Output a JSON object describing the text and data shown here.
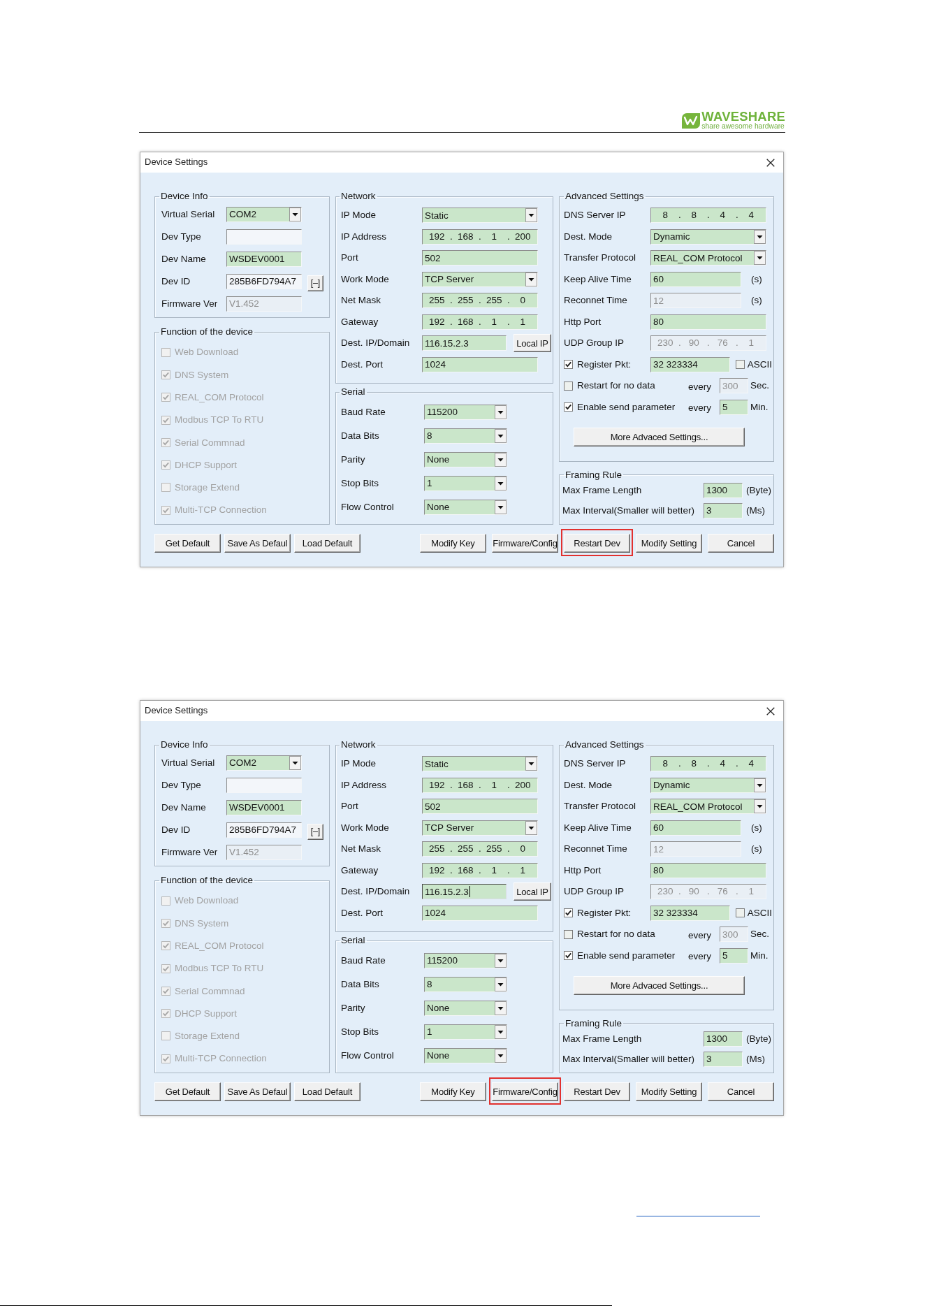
{
  "header": {
    "logo_name": "WAVESHARE",
    "tagline": "share awesome hardware"
  },
  "dialogs": [
    {
      "title": "Device Settings",
      "columns": [
        [
          {
            "title": "Device Info",
            "rows": [
              {
                "kind": "field",
                "label": "Virtual Serial",
                "field": {
                  "kind": "combo",
                  "value": "COM2",
                  "readonly": false,
                  "disabled": false,
                  "focused": false
                }
              },
              {
                "kind": "field",
                "label": "Dev Type",
                "field": {
                  "kind": "text",
                  "readonly": true,
                  "disabled": false,
                  "focused": false
                }
              },
              {
                "kind": "field",
                "label": "Dev Name",
                "field": {
                  "kind": "text",
                  "value": "WSDEV0001",
                  "readonly": false,
                  "disabled": false,
                  "focused": false
                }
              },
              {
                "kind": "field",
                "label": "Dev ID",
                "field": {
                  "kind": "text",
                  "value": "285B6FD794A7",
                  "readonly": true,
                  "disabled": false,
                  "focused": false
                },
                "button": "[–]"
              },
              {
                "kind": "field",
                "label": "Firmware Ver",
                "field": {
                  "kind": "text",
                  "value": "V1.452",
                  "readonly": false,
                  "disabled": true,
                  "focused": false
                }
              }
            ]
          },
          {
            "title": "Function of the device",
            "rows": [
              {
                "kind": "check",
                "label": "Web Download",
                "checked": false,
                "disabled": true
              },
              {
                "kind": "check",
                "label": "DNS System",
                "checked": true,
                "disabled": true
              },
              {
                "kind": "check",
                "label": "REAL_COM Protocol",
                "checked": true,
                "disabled": true
              },
              {
                "kind": "check",
                "label": "Modbus TCP To RTU",
                "checked": true,
                "disabled": true
              },
              {
                "kind": "check",
                "label": "Serial Commnad",
                "checked": true,
                "disabled": true
              },
              {
                "kind": "check",
                "label": "DHCP Support",
                "checked": true,
                "disabled": true
              },
              {
                "kind": "check",
                "label": "Storage Extend",
                "checked": false,
                "disabled": true
              },
              {
                "kind": "check",
                "label": "Multi-TCP Connection",
                "checked": true,
                "disabled": true
              }
            ]
          }
        ],
        [
          {
            "title": "Network",
            "rows": [
              {
                "kind": "field",
                "label": "IP Mode",
                "field": {
                  "kind": "combo",
                  "value": "Static",
                  "readonly": false,
                  "disabled": false,
                  "focused": false
                }
              },
              {
                "kind": "field",
                "label": "IP Address",
                "field": {
                  "kind": "ip",
                  "value": "192 . 168 . 1 . 200",
                  "readonly": false,
                  "disabled": false,
                  "focused": false
                }
              },
              {
                "kind": "field",
                "label": "Port",
                "field": {
                  "kind": "text",
                  "value": "502",
                  "readonly": false,
                  "disabled": false,
                  "focused": false
                }
              },
              {
                "kind": "field",
                "label": "Work Mode",
                "field": {
                  "kind": "combo",
                  "value": "TCP Server",
                  "readonly": false,
                  "disabled": false,
                  "focused": false
                }
              },
              {
                "kind": "field",
                "label": "Net Mask",
                "field": {
                  "kind": "ip",
                  "value": "255 . 255 . 255 . 0",
                  "readonly": false,
                  "disabled": false,
                  "focused": false
                }
              },
              {
                "kind": "field",
                "label": "Gateway",
                "field": {
                  "kind": "ip",
                  "value": "192 . 168 . 1 . 1",
                  "readonly": false,
                  "disabled": false,
                  "focused": false
                }
              },
              {
                "kind": "field",
                "label": "Dest. IP/Domain",
                "field": {
                  "kind": "text",
                  "value": "116.15.2.3",
                  "readonly": false,
                  "disabled": false,
                  "focused": false
                },
                "button": "Local IP"
              },
              {
                "kind": "field",
                "label": "Dest. Port",
                "field": {
                  "kind": "text",
                  "value": "1024",
                  "readonly": false,
                  "disabled": false,
                  "focused": false
                }
              }
            ]
          },
          {
            "title": "Serial",
            "rows": [
              {
                "kind": "field",
                "label": "Baud Rate",
                "field": {
                  "kind": "combo",
                  "value": "115200",
                  "readonly": false,
                  "disabled": false,
                  "focused": false
                }
              },
              {
                "kind": "field",
                "label": "Data Bits",
                "field": {
                  "kind": "combo",
                  "value": "8",
                  "readonly": false,
                  "disabled": false,
                  "focused": false
                }
              },
              {
                "kind": "field",
                "label": "Parity",
                "field": {
                  "kind": "combo",
                  "value": "None",
                  "readonly": false,
                  "disabled": false,
                  "focused": false
                }
              },
              {
                "kind": "field",
                "label": "Stop Bits",
                "field": {
                  "kind": "combo",
                  "value": "1",
                  "readonly": false,
                  "disabled": false,
                  "focused": false
                }
              },
              {
                "kind": "field",
                "label": "Flow Control",
                "field": {
                  "kind": "combo",
                  "value": "None",
                  "readonly": false,
                  "disabled": false,
                  "focused": false
                }
              }
            ]
          }
        ],
        [
          {
            "title": "Advanced Settings",
            "rows": [
              {
                "kind": "field",
                "label": "DNS Server IP",
                "field": {
                  "kind": "ip",
                  "value": "8 . 8 . 4 . 4",
                  "readonly": false,
                  "disabled": false,
                  "focused": false
                }
              },
              {
                "kind": "field",
                "label": "Dest. Mode",
                "field": {
                  "kind": "combo",
                  "value": "Dynamic",
                  "readonly": false,
                  "disabled": false,
                  "focused": false
                }
              },
              {
                "kind": "field",
                "label": "Transfer Protocol",
                "field": {
                  "kind": "combo",
                  "value": "REAL_COM Protocol",
                  "readonly": false,
                  "disabled": false,
                  "focused": false
                }
              },
              {
                "kind": "field",
                "label": "Keep Alive Time",
                "field": {
                  "kind": "text",
                  "value": "60",
                  "readonly": false,
                  "disabled": false,
                  "focused": false
                },
                "unit": "(s)"
              },
              {
                "kind": "field",
                "label": "Reconnet Time",
                "field": {
                  "kind": "text",
                  "value": "12",
                  "readonly": false,
                  "disabled": true,
                  "focused": false
                },
                "unit": "(s)"
              },
              {
                "kind": "field",
                "label": "Http Port",
                "field": {
                  "kind": "text",
                  "value": "80",
                  "readonly": false,
                  "disabled": false,
                  "focused": false
                }
              },
              {
                "kind": "field",
                "label": "UDP Group IP",
                "field": {
                  "kind": "ip",
                  "value": "230 . 90 . 76 . 1",
                  "readonly": false,
                  "disabled": true,
                  "focused": false
                }
              },
              {
                "kind": "check_field",
                "label": "Register Pkt:",
                "checked": true,
                "disabled": false,
                "field": {
                  "kind": "text",
                  "value": "32 323334",
                  "readonly": false,
                  "disabled": false,
                  "focused": false
                },
                "option": {
                  "label": "ASCII",
                  "checked": false,
                  "disabled": false
                }
              },
              {
                "kind": "check_every",
                "label": "Restart for no data",
                "checked": false,
                "disabled": false,
                "every": "every",
                "field": {
                  "kind": "text",
                  "value": "300",
                  "readonly": false,
                  "disabled": true,
                  "focused": false
                },
                "unit": "Sec."
              },
              {
                "kind": "check_every",
                "label": "Enable send parameter",
                "checked": true,
                "disabled": false,
                "every": "every",
                "field": {
                  "kind": "text",
                  "value": "5",
                  "readonly": false,
                  "disabled": false,
                  "focused": false
                },
                "unit": "Min."
              },
              {
                "kind": "button",
                "label": "More Advaced Settings..."
              }
            ]
          },
          {
            "title": "Framing Rule",
            "rows": [
              {
                "kind": "field",
                "label": "Max Frame Length",
                "field": {
                  "kind": "text",
                  "value": "1300",
                  "readonly": false,
                  "disabled": false,
                  "focused": false
                },
                "unit": "(Byte)"
              },
              {
                "kind": "field",
                "label": "Max Interval(Smaller will better)",
                "field": {
                  "kind": "text",
                  "value": "3",
                  "readonly": false,
                  "disabled": false,
                  "focused": false
                },
                "unit": "(Ms)"
              }
            ]
          }
        ]
      ],
      "buttons_left": [
        {
          "label": "Get Default",
          "highlighted": false
        },
        {
          "label": "Save As Defaul",
          "highlighted": false
        },
        {
          "label": "Load Default",
          "highlighted": false
        }
      ],
      "buttons_right": [
        {
          "label": "Modify Key",
          "highlighted": false
        },
        {
          "label": "Firmware/Config",
          "highlighted": false
        },
        {
          "label": "Restart Dev",
          "highlighted": true
        },
        {
          "label": "Modify Setting",
          "highlighted": false
        },
        {
          "label": "Cancel",
          "highlighted": false
        }
      ]
    },
    {
      "title": "Device Settings",
      "columns": [
        [
          {
            "title": "Device Info",
            "rows": [
              {
                "kind": "field",
                "label": "Virtual Serial",
                "field": {
                  "kind": "combo",
                  "value": "COM2",
                  "readonly": false,
                  "disabled": false,
                  "focused": false
                }
              },
              {
                "kind": "field",
                "label": "Dev Type",
                "field": {
                  "kind": "text",
                  "readonly": true,
                  "disabled": false,
                  "focused": false
                }
              },
              {
                "kind": "field",
                "label": "Dev Name",
                "field": {
                  "kind": "text",
                  "value": "WSDEV0001",
                  "readonly": false,
                  "disabled": false,
                  "focused": false
                }
              },
              {
                "kind": "field",
                "label": "Dev ID",
                "field": {
                  "kind": "text",
                  "value": "285B6FD794A7",
                  "readonly": true,
                  "disabled": false,
                  "focused": false
                },
                "button": "[–]"
              },
              {
                "kind": "field",
                "label": "Firmware Ver",
                "field": {
                  "kind": "text",
                  "value": "V1.452",
                  "readonly": false,
                  "disabled": true,
                  "focused": false
                }
              }
            ]
          },
          {
            "title": "Function of the device",
            "rows": [
              {
                "kind": "check",
                "label": "Web Download",
                "checked": false,
                "disabled": true
              },
              {
                "kind": "check",
                "label": "DNS System",
                "checked": true,
                "disabled": true
              },
              {
                "kind": "check",
                "label": "REAL_COM Protocol",
                "checked": true,
                "disabled": true
              },
              {
                "kind": "check",
                "label": "Modbus TCP To RTU",
                "checked": true,
                "disabled": true
              },
              {
                "kind": "check",
                "label": "Serial Commnad",
                "checked": true,
                "disabled": true
              },
              {
                "kind": "check",
                "label": "DHCP Support",
                "checked": true,
                "disabled": true
              },
              {
                "kind": "check",
                "label": "Storage Extend",
                "checked": false,
                "disabled": true
              },
              {
                "kind": "check",
                "label": "Multi-TCP Connection",
                "checked": true,
                "disabled": true
              }
            ]
          }
        ],
        [
          {
            "title": "Network",
            "rows": [
              {
                "kind": "field",
                "label": "IP Mode",
                "field": {
                  "kind": "combo",
                  "value": "Static",
                  "readonly": false,
                  "disabled": false,
                  "focused": false
                }
              },
              {
                "kind": "field",
                "label": "IP Address",
                "field": {
                  "kind": "ip",
                  "value": "192 . 168 . 1 . 200",
                  "readonly": false,
                  "disabled": false,
                  "focused": false
                }
              },
              {
                "kind": "field",
                "label": "Port",
                "field": {
                  "kind": "text",
                  "value": "502",
                  "readonly": false,
                  "disabled": false,
                  "focused": false
                }
              },
              {
                "kind": "field",
                "label": "Work Mode",
                "field": {
                  "kind": "combo",
                  "value": "TCP Server",
                  "readonly": false,
                  "disabled": false,
                  "focused": false
                }
              },
              {
                "kind": "field",
                "label": "Net Mask",
                "field": {
                  "kind": "ip",
                  "value": "255 . 255 . 255 . 0",
                  "readonly": false,
                  "disabled": false,
                  "focused": false
                }
              },
              {
                "kind": "field",
                "label": "Gateway",
                "field": {
                  "kind": "ip",
                  "value": "192 . 168 . 1 . 1",
                  "readonly": false,
                  "disabled": false,
                  "focused": false
                }
              },
              {
                "kind": "field",
                "label": "Dest. IP/Domain",
                "field": {
                  "kind": "text",
                  "value": "116.15.2.3",
                  "readonly": false,
                  "disabled": false,
                  "focused": true
                },
                "button": "Local IP"
              },
              {
                "kind": "field",
                "label": "Dest. Port",
                "field": {
                  "kind": "text",
                  "value": "1024",
                  "readonly": false,
                  "disabled": false,
                  "focused": false
                }
              }
            ]
          },
          {
            "title": "Serial",
            "rows": [
              {
                "kind": "field",
                "label": "Baud Rate",
                "field": {
                  "kind": "combo",
                  "value": "115200",
                  "readonly": false,
                  "disabled": false,
                  "focused": false
                }
              },
              {
                "kind": "field",
                "label": "Data Bits",
                "field": {
                  "kind": "combo",
                  "value": "8",
                  "readonly": false,
                  "disabled": false,
                  "focused": false
                }
              },
              {
                "kind": "field",
                "label": "Parity",
                "field": {
                  "kind": "combo",
                  "value": "None",
                  "readonly": false,
                  "disabled": false,
                  "focused": false
                }
              },
              {
                "kind": "field",
                "label": "Stop Bits",
                "field": {
                  "kind": "combo",
                  "value": "1",
                  "readonly": false,
                  "disabled": false,
                  "focused": false
                }
              },
              {
                "kind": "field",
                "label": "Flow Control",
                "field": {
                  "kind": "combo",
                  "value": "None",
                  "readonly": false,
                  "disabled": false,
                  "focused": false
                }
              }
            ]
          }
        ],
        [
          {
            "title": "Advanced Settings",
            "rows": [
              {
                "kind": "field",
                "label": "DNS Server IP",
                "field": {
                  "kind": "ip",
                  "value": "8 . 8 . 4 . 4",
                  "readonly": false,
                  "disabled": false,
                  "focused": false
                }
              },
              {
                "kind": "field",
                "label": "Dest. Mode",
                "field": {
                  "kind": "combo",
                  "value": "Dynamic",
                  "readonly": false,
                  "disabled": false,
                  "focused": false
                }
              },
              {
                "kind": "field",
                "label": "Transfer Protocol",
                "field": {
                  "kind": "combo",
                  "value": "REAL_COM Protocol",
                  "readonly": false,
                  "disabled": false,
                  "focused": false
                }
              },
              {
                "kind": "field",
                "label": "Keep Alive Time",
                "field": {
                  "kind": "text",
                  "value": "60",
                  "readonly": false,
                  "disabled": false,
                  "focused": false
                },
                "unit": "(s)"
              },
              {
                "kind": "field",
                "label": "Reconnet Time",
                "field": {
                  "kind": "text",
                  "value": "12",
                  "readonly": false,
                  "disabled": true,
                  "focused": false
                },
                "unit": "(s)"
              },
              {
                "kind": "field",
                "label": "Http Port",
                "field": {
                  "kind": "text",
                  "value": "80",
                  "readonly": false,
                  "disabled": false,
                  "focused": false
                }
              },
              {
                "kind": "field",
                "label": "UDP Group IP",
                "field": {
                  "kind": "ip",
                  "value": "230 . 90 . 76 . 1",
                  "readonly": false,
                  "disabled": true,
                  "focused": false
                }
              },
              {
                "kind": "check_field",
                "label": "Register Pkt:",
                "checked": true,
                "disabled": false,
                "field": {
                  "kind": "text",
                  "value": "32 323334",
                  "readonly": false,
                  "disabled": false,
                  "focused": false
                },
                "option": {
                  "label": "ASCII",
                  "checked": false,
                  "disabled": false
                }
              },
              {
                "kind": "check_every",
                "label": "Restart for no data",
                "checked": false,
                "disabled": false,
                "every": "every",
                "field": {
                  "kind": "text",
                  "value": "300",
                  "readonly": false,
                  "disabled": true,
                  "focused": false
                },
                "unit": "Sec."
              },
              {
                "kind": "check_every",
                "label": "Enable send parameter",
                "checked": true,
                "disabled": false,
                "every": "every",
                "field": {
                  "kind": "text",
                  "value": "5",
                  "readonly": false,
                  "disabled": false,
                  "focused": false
                },
                "unit": "Min."
              },
              {
                "kind": "button",
                "label": "More Advaced Settings..."
              }
            ]
          },
          {
            "title": "Framing Rule",
            "rows": [
              {
                "kind": "field",
                "label": "Max Frame Length",
                "field": {
                  "kind": "text",
                  "value": "1300",
                  "readonly": false,
                  "disabled": false,
                  "focused": false
                },
                "unit": "(Byte)"
              },
              {
                "kind": "field",
                "label": "Max Interval(Smaller will better)",
                "field": {
                  "kind": "text",
                  "value": "3",
                  "readonly": false,
                  "disabled": false,
                  "focused": false
                },
                "unit": "(Ms)"
              }
            ]
          }
        ]
      ],
      "buttons_left": [
        {
          "label": "Get Default",
          "highlighted": false
        },
        {
          "label": "Save As Defaul",
          "highlighted": false
        },
        {
          "label": "Load Default",
          "highlighted": false
        }
      ],
      "buttons_right": [
        {
          "label": "Modify Key",
          "highlighted": false
        },
        {
          "label": "Firmware/Config",
          "highlighted": true
        },
        {
          "label": "Restart Dev",
          "highlighted": false
        },
        {
          "label": "Modify Setting",
          "highlighted": false
        },
        {
          "label": "Cancel",
          "highlighted": false
        }
      ]
    }
  ]
}
